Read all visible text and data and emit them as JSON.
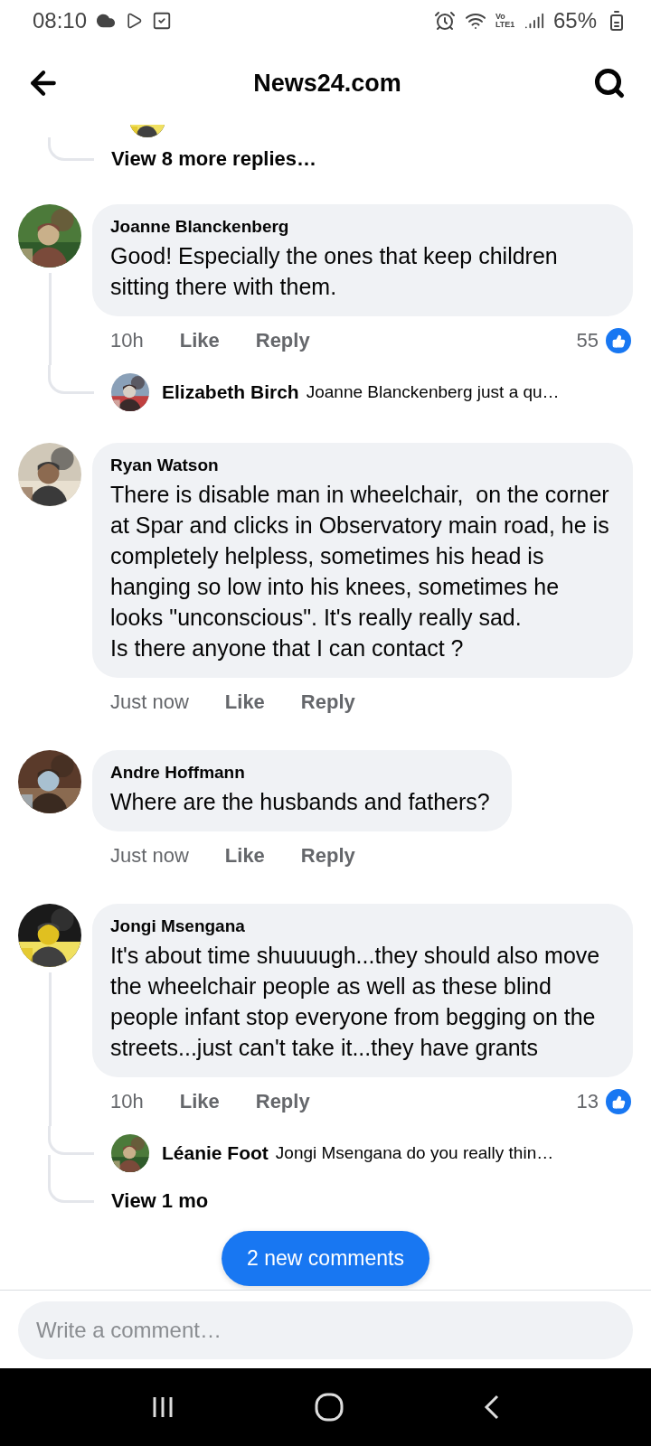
{
  "status_bar": {
    "time": "08:10",
    "network": "Vo LTE1",
    "battery": "65%"
  },
  "header": {
    "title": "News24.com"
  },
  "thread_top": {
    "more_replies": "View 8 more replies…"
  },
  "comments": [
    {
      "name": "Joanne Blanckenberg",
      "text": "Good! Especially the ones that keep children sitting there with them.",
      "time": "10h",
      "actions": [
        "Like",
        "Reply"
      ],
      "reactions": "55",
      "replies": [
        {
          "name": "Elizabeth Birch",
          "text": "Joanne Blanckenberg just a qu…"
        }
      ]
    },
    {
      "name": "Ryan Watson",
      "text": "There is disable man in wheelchair,  on the corner at Spar and clicks in Observatory main road, he is completely helpless, sometimes his head is hanging so low into his knees, sometimes he looks \"unconscious\". It's really really sad.\nIs there anyone that I can contact ?",
      "time": "Just now",
      "actions": [
        "Like",
        "Reply"
      ]
    },
    {
      "name": "Andre Hoffmann",
      "text": "Where are the husbands and fathers?",
      "time": "Just now",
      "actions": [
        "Like",
        "Reply"
      ]
    },
    {
      "name": "Jongi Msengana",
      "text": "It's about time shuuuugh...they should also move the wheelchair people as well as these blind people infant stop everyone from begging on the streets...just can't take it...they have grants",
      "time": "10h",
      "actions": [
        "Like",
        "Reply"
      ],
      "reactions": "13",
      "replies": [
        {
          "name": "Léanie Foot",
          "text": "Jongi Msengana do you really thin…"
        }
      ],
      "more_replies": "View 1 mo"
    }
  ],
  "new_comments_pill": "2 new comments",
  "composer": {
    "placeholder": "Write a comment…"
  }
}
